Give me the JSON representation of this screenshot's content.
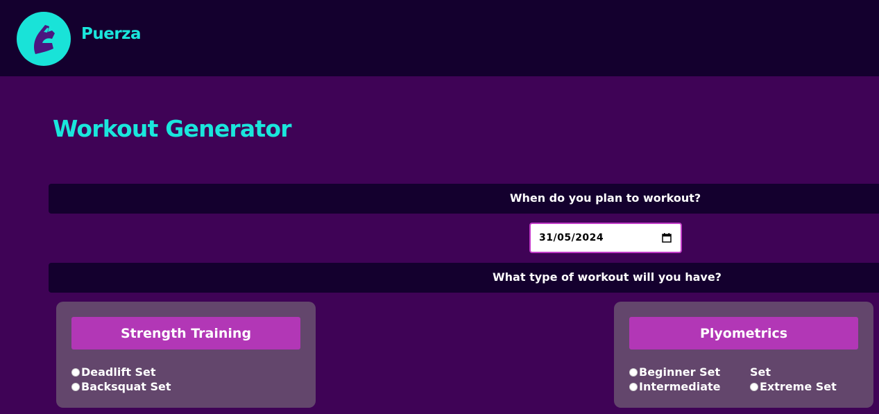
{
  "brand": {
    "name": "Puerza",
    "logo_icon": "flexed-arm-icon"
  },
  "page": {
    "title": "Workout Generator"
  },
  "form": {
    "date_question": "When do you plan to workout?",
    "date_value": "31/05/2024",
    "type_question": "What type of workout will you have?"
  },
  "cards": {
    "strength": {
      "title": "Strength Training",
      "options": [
        "Deadlift Set",
        "Backsquat Set"
      ]
    },
    "plyo": {
      "title": "Plyometrics",
      "options": [
        "Beginner Set",
        "Intermediate",
        "Set",
        "Extreme Set"
      ]
    }
  },
  "colors": {
    "background": "#3f0356",
    "header": "#14002e",
    "accent": "#1ae6dc",
    "card": "#63466c",
    "card_header": "#b237b6"
  }
}
